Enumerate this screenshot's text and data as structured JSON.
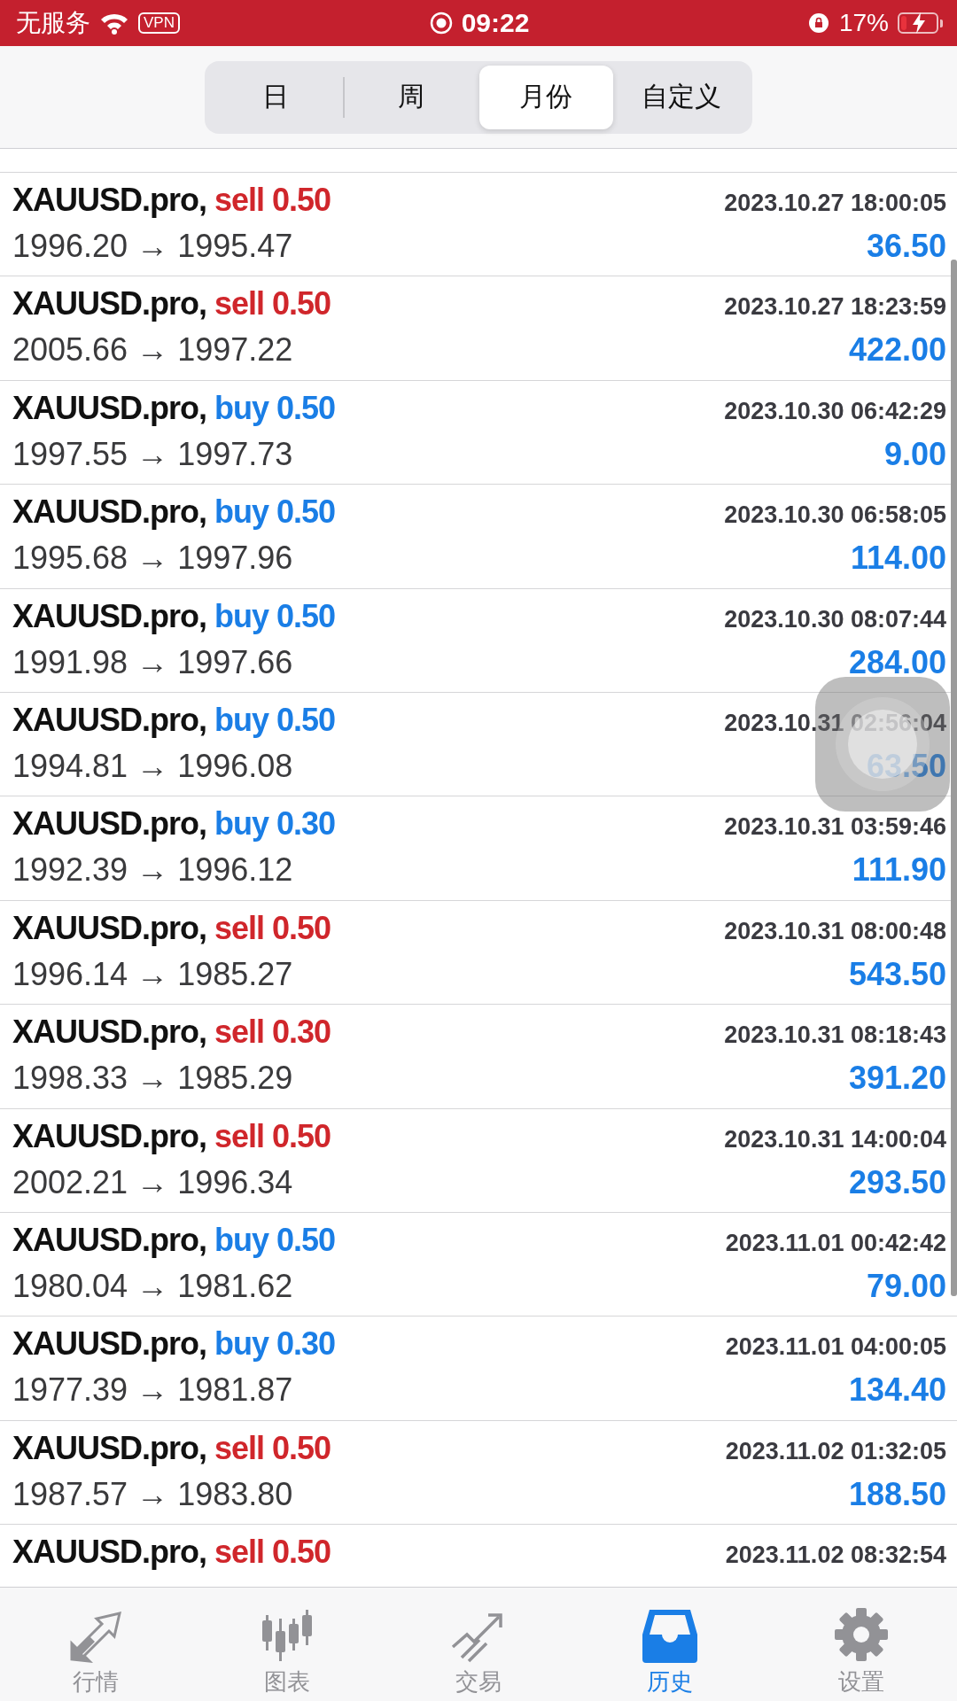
{
  "status_bar": {
    "carrier": "无服务",
    "vpn": "VPN",
    "time": "09:22",
    "battery_text": "17%",
    "battery": {
      "level": 0.17,
      "charging": true
    }
  },
  "segments": [
    {
      "label": "日",
      "selected": false
    },
    {
      "label": "周",
      "selected": false
    },
    {
      "label": "月份",
      "selected": true
    },
    {
      "label": "自定义",
      "selected": false
    }
  ],
  "deals": [
    {
      "symbol": "XAUUSD.pro,",
      "side": "sell",
      "kind": "sell",
      "volume": "0.50",
      "time": "2023.10.27 18:00:05",
      "prices": "1996.20 → 1995.47",
      "profit": "36.50"
    },
    {
      "symbol": "XAUUSD.pro,",
      "side": "sell",
      "kind": "sell",
      "volume": "0.50",
      "time": "2023.10.27 18:23:59",
      "prices": "2005.66 → 1997.22",
      "profit": "422.00"
    },
    {
      "symbol": "XAUUSD.pro,",
      "side": "buy",
      "kind": "buy",
      "volume": "0.50",
      "time": "2023.10.30 06:42:29",
      "prices": "1997.55 → 1997.73",
      "profit": "9.00"
    },
    {
      "symbol": "XAUUSD.pro,",
      "side": "buy",
      "kind": "buy",
      "volume": "0.50",
      "time": "2023.10.30 06:58:05",
      "prices": "1995.68 → 1997.96",
      "profit": "114.00"
    },
    {
      "symbol": "XAUUSD.pro,",
      "side": "buy",
      "kind": "buy",
      "volume": "0.50",
      "time": "2023.10.30 08:07:44",
      "prices": "1991.98 → 1997.66",
      "profit": "284.00"
    },
    {
      "symbol": "XAUUSD.pro,",
      "side": "buy",
      "kind": "buy",
      "volume": "0.50",
      "time": "2023.10.31 02:56:04",
      "prices": "1994.81 → 1996.08",
      "profit": "63.50"
    },
    {
      "symbol": "XAUUSD.pro,",
      "side": "buy",
      "kind": "buy",
      "volume": "0.30",
      "time": "2023.10.31 03:59:46",
      "prices": "1992.39 → 1996.12",
      "profit": "111.90"
    },
    {
      "symbol": "XAUUSD.pro,",
      "side": "sell",
      "kind": "sell",
      "volume": "0.50",
      "time": "2023.10.31 08:00:48",
      "prices": "1996.14 → 1985.27",
      "profit": "543.50"
    },
    {
      "symbol": "XAUUSD.pro,",
      "side": "sell",
      "kind": "sell",
      "volume": "0.30",
      "time": "2023.10.31 08:18:43",
      "prices": "1998.33 → 1985.29",
      "profit": "391.20"
    },
    {
      "symbol": "XAUUSD.pro,",
      "side": "sell",
      "kind": "sell",
      "volume": "0.50",
      "time": "2023.10.31 14:00:04",
      "prices": "2002.21 → 1996.34",
      "profit": "293.50"
    },
    {
      "symbol": "XAUUSD.pro,",
      "side": "buy",
      "kind": "buy",
      "volume": "0.50",
      "time": "2023.11.01 00:42:42",
      "prices": "1980.04 → 1981.62",
      "profit": "79.00"
    },
    {
      "symbol": "XAUUSD.pro,",
      "side": "buy",
      "kind": "buy",
      "volume": "0.30",
      "time": "2023.11.01 04:00:05",
      "prices": "1977.39 → 1981.87",
      "profit": "134.40"
    },
    {
      "symbol": "XAUUSD.pro,",
      "side": "sell",
      "kind": "sell",
      "volume": "0.50",
      "time": "2023.11.02 01:32:05",
      "prices": "1987.57 → 1983.80",
      "profit": "188.50"
    },
    {
      "symbol": "XAUUSD.pro,",
      "side": "sell",
      "kind": "sell",
      "volume": "0.50",
      "time": "2023.11.02 08:32:54"
    }
  ],
  "tab_bar": [
    {
      "label": "行情",
      "kind": "quotes",
      "selected": false
    },
    {
      "label": "图表",
      "kind": "chart",
      "selected": false
    },
    {
      "label": "交易",
      "kind": "trade",
      "selected": false
    },
    {
      "label": "历史",
      "kind": "history",
      "selected": true
    },
    {
      "label": "设置",
      "kind": "settings",
      "selected": false
    }
  ]
}
